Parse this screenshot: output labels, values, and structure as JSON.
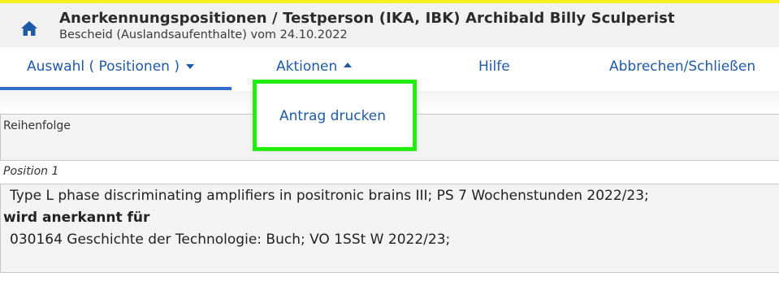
{
  "header": {
    "title": "Anerkennungspositionen  / Testperson (IKA, IBK) Archibald Billy Sculperist",
    "subtitle": "Bescheid (Auslandsaufenthalte) vom 24.10.2022",
    "home_icon": "home-icon"
  },
  "nav": {
    "items": [
      {
        "label": "Auswahl ( Positionen )",
        "icon": "caret-down-icon",
        "active": true
      },
      {
        "label": "Aktionen",
        "icon": "caret-up-icon",
        "open": true
      },
      {
        "label": "Hilfe"
      },
      {
        "label": "Abbrechen/Schließen"
      }
    ]
  },
  "dropdown": {
    "items": [
      {
        "label": "Antrag drucken"
      }
    ]
  },
  "content": {
    "reihenfolge_label": "Reihenfolge",
    "position_label": "Position 1",
    "source_course": "Type L phase discriminating amplifiers in positronic brains III; PS 7 Wochenstunden 2022/23;",
    "recognized_label": "wird anerkannt für",
    "target_course": "030164 Geschichte der Technologie: Buch; VO 1SSt W 2022/23;"
  },
  "colors": {
    "accent": "#1f5aa6",
    "top_bar": "#f5ef1e",
    "highlight": "#22ee0c",
    "active_underline": "#2f6fc9"
  }
}
